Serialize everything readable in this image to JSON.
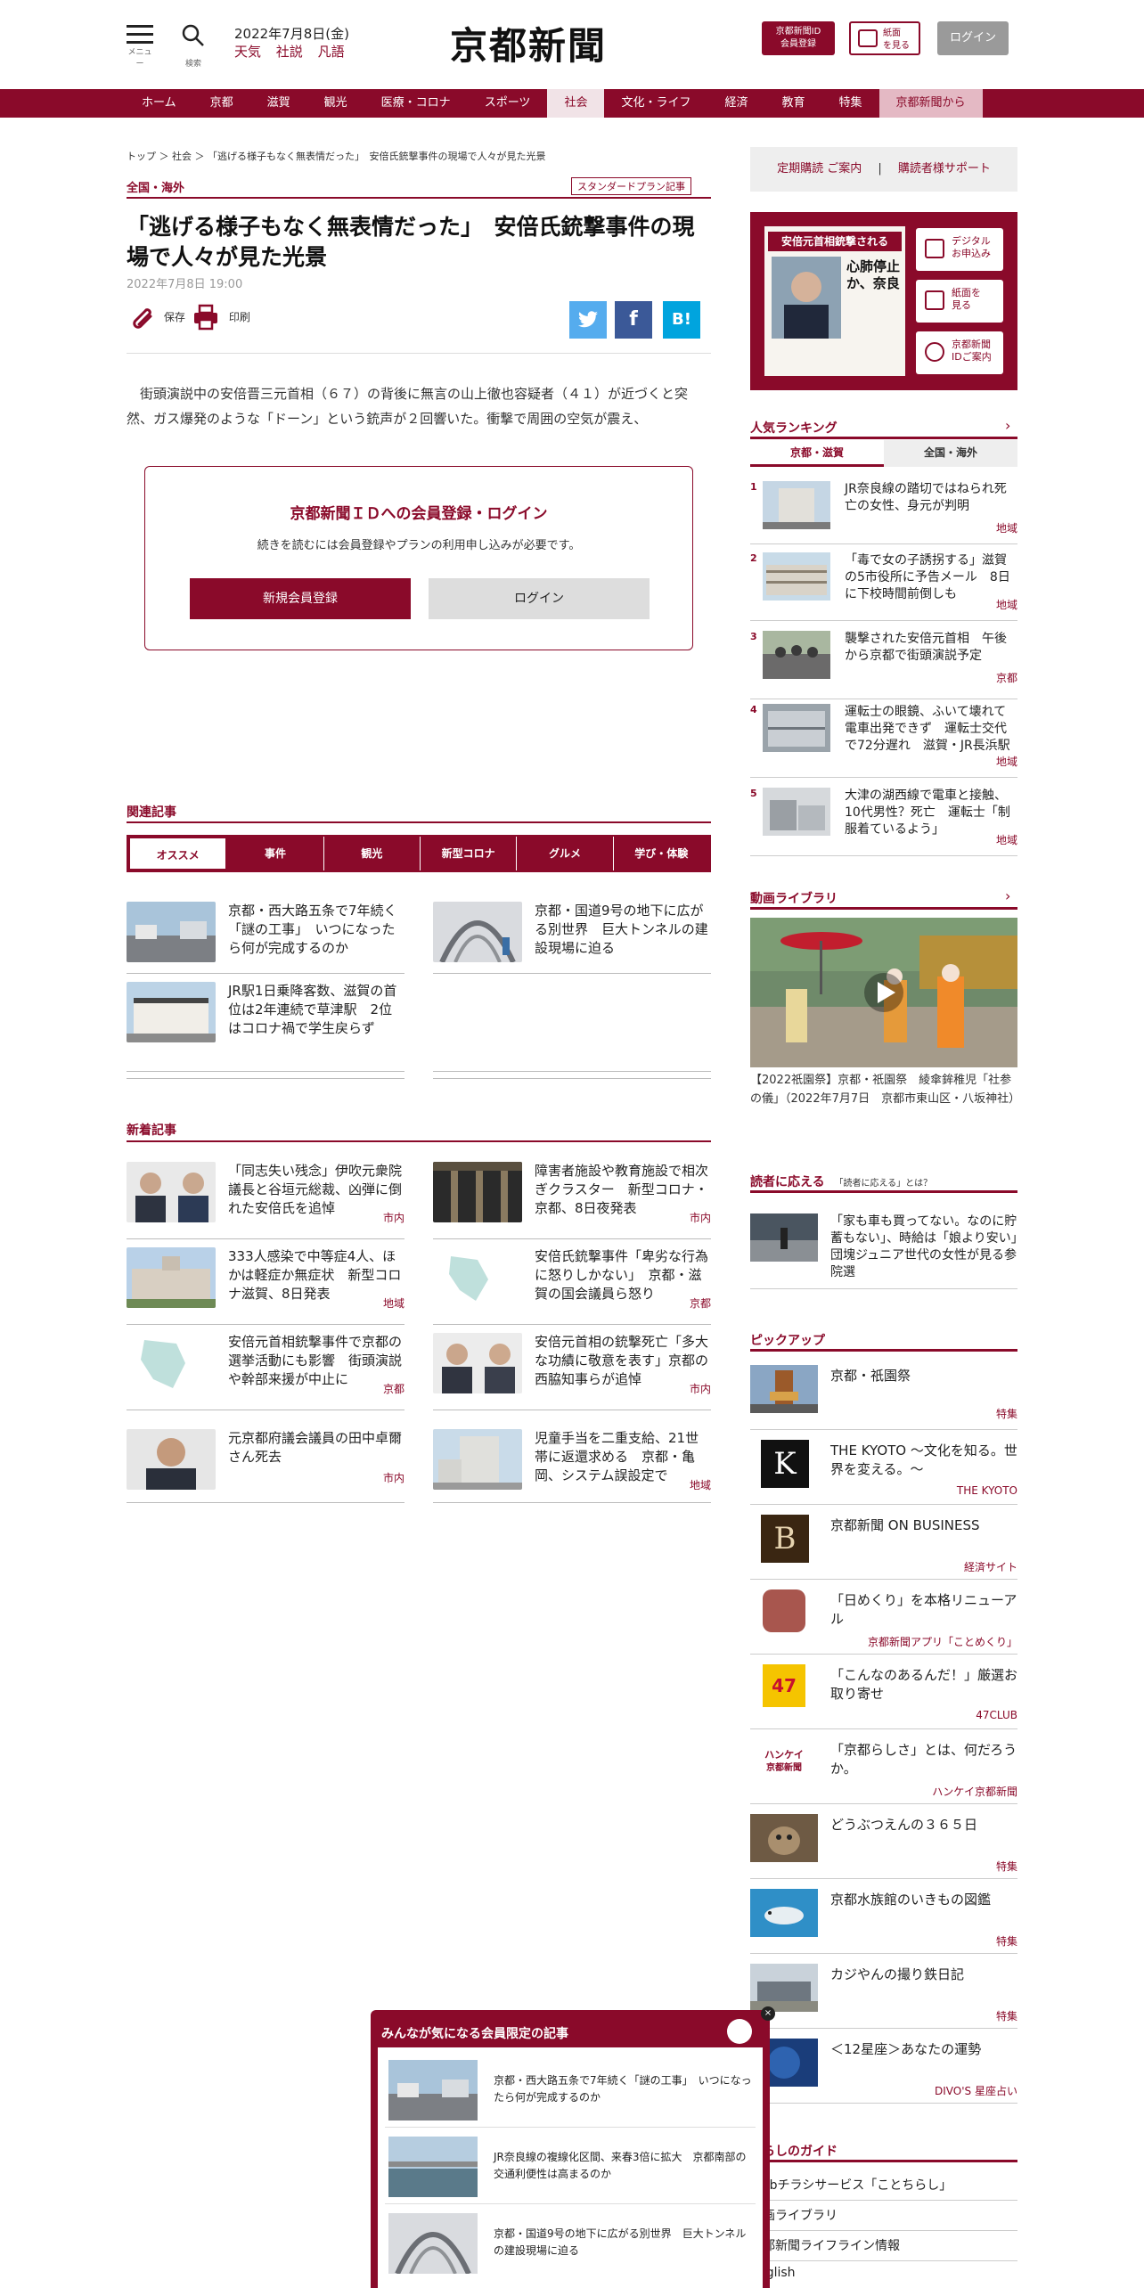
{
  "header": {
    "menu_label": "メニュー",
    "search_label": "検索",
    "date": "2022年7月8日(金)",
    "quick_links": [
      "天気",
      "社説",
      "凡語"
    ],
    "logo": "京都新聞",
    "member_register_line1": "京都新聞ID",
    "member_register_line2": "会員登録",
    "paper_view_line1": "紙面",
    "paper_view_line2": "を見る",
    "login": "ログイン"
  },
  "nav": [
    "ホーム",
    "京都",
    "滋賀",
    "観光",
    "医療・コロナ",
    "スポーツ",
    "社会",
    "文化・ライフ",
    "経済",
    "教育",
    "特集",
    "京都新聞から"
  ],
  "breadcrumb": "トップ ＞ 社会 ＞ 「逃げる様子もなく無表情だった」　安倍氏銃撃事件の現場で人々が見た光景",
  "article": {
    "category": "全国・海外",
    "plan_badge": "スタンダードプラン記事",
    "title": "「逃げる様子もなく無表情だった」　安倍氏銃撃事件の現場で人々が見た光景",
    "published": "2022年7月8日 19:00",
    "save": "保存",
    "print": "印刷",
    "lead": "街頭演説中の安倍晋三元首相（６７）の背後に無言の山上徹也容疑者（４１）が近づくと突然、ガス爆発のような「ドーン」という銃声が２回響いた。衝撃で周囲の空気が震え、"
  },
  "share": {
    "twitter": "t",
    "facebook": "f",
    "hatena": "B!"
  },
  "login_box": {
    "heading": "京都新聞ＩＤへの会員登録・ログイン",
    "text": "続きを読むには会員登録やプランの利用申し込みが必要です。",
    "register": "新規会員登録",
    "login": "ログイン"
  },
  "related": {
    "heading": "関連記事",
    "tabs": [
      "オススメ",
      "事件",
      "観光",
      "新型コロナ",
      "グルメ",
      "学び・体験"
    ],
    "items": [
      {
        "text": "京都・西大路五条で7年続く「謎の工事」　いつになったら何が完成するのか"
      },
      {
        "text": "京都・国道9号の地下に広がる別世界　巨大トンネルの建設現場に迫る"
      },
      {
        "text": "JR駅1日乗降客数、滋賀の首位は2年連続で草津駅　2位はコロナ禍で学生戻らず"
      }
    ]
  },
  "latest": {
    "heading": "新着記事",
    "items": [
      {
        "text": "「同志失い残念」伊吹元衆院議長と谷垣元総裁、凶弾に倒れた安倍氏を追悼",
        "tag": "市内"
      },
      {
        "text": "障害者施設や教育施設で相次ぎクラスター　新型コロナ・京都、8日夜発表",
        "tag": "市内"
      },
      {
        "text": "333人感染で中等症4人、ほかは軽症か無症状　新型コロナ滋賀、8日発表",
        "tag": "地域"
      },
      {
        "text": "安倍氏銃撃事件「卑劣な行為に怒りしかない」　京都・滋賀の国会議員ら怒り",
        "tag": "京都"
      },
      {
        "text": "安倍元首相銃撃事件で京都の選挙活動にも影響　街頭演説や幹部来援が中止に",
        "tag": "京都"
      },
      {
        "text": "安倍元首相の銃撃死亡「多大な功績に敬意を表す」京都の西脇知事らが追悼",
        "tag": "市内"
      },
      {
        "text": "元京都府議会議員の田中卓爾さん死去",
        "tag": "市内"
      },
      {
        "text": "児童手当を二重支給、21世帯に返還求める　京都・亀岡、システム誤設定で",
        "tag": "地域"
      }
    ]
  },
  "sidebar": {
    "subscribe": "定期購読 ご案内",
    "support": "購読者様サポート",
    "paper_headline": "安倍元首相銃撃される",
    "paper_sub": "心肺停止か、奈良",
    "paper_buttons": [
      {
        "l1": "デジタル",
        "l2": "お申込み"
      },
      {
        "l1": "紙面を",
        "l2": "見る"
      },
      {
        "l1": "京都新聞",
        "l2": "IDご案内"
      }
    ],
    "ranking": {
      "heading": "人気ランキング",
      "tabs": [
        "京都・滋賀",
        "全国・海外"
      ],
      "items": [
        {
          "rank": "1",
          "text": "JR奈良線の踏切ではねられ死亡の女性、身元が判明",
          "tag": "地域"
        },
        {
          "rank": "2",
          "text": "「毒で女の子誘拐する」滋賀の5市役所に予告メール　8日に下校時間前倒しも",
          "tag": "地域"
        },
        {
          "rank": "3",
          "text": "襲撃された安倍元首相　午後から京都で街頭演説予定",
          "tag": "京都"
        },
        {
          "rank": "4",
          "text": "運転士の眼鏡、ふいて壊れて電車出発できず　運転士交代で72分遅れ　滋賀・JR長浜駅",
          "tag": "地域"
        },
        {
          "rank": "5",
          "text": "大津の湖西線で電車と接触、10代男性？死亡　運転士「制服着ているよう」",
          "tag": "地域"
        }
      ]
    },
    "video": {
      "heading": "動画ライブラリ",
      "caption": "【2022祇園祭】京都・祇園祭　綾傘鉾稚児「社参の儀」（2022年7月7日　京都市東山区・八坂神社）"
    },
    "reader": {
      "heading": "読者に応える",
      "sub": "「読者に応える」とは？",
      "text": "「家も車も買ってない。なのに貯蓄もない」、時給は「娘より安い」団塊ジュニア世代の女性が見る参院選"
    },
    "pickup": {
      "heading": "ピックアップ",
      "items": [
        {
          "text": "京都・祇園祭",
          "tag": "特集"
        },
        {
          "text": "THE KYOTO ～文化を知る。世界を変える。～",
          "tag": "THE KYOTO"
        },
        {
          "text": "京都新聞 ON BUSINESS",
          "tag": "経済サイト"
        },
        {
          "text": "「日めくり」を本格リニューアル",
          "tag": "京都新聞アプリ「ことめくり」"
        },
        {
          "text": "「こんなのあるんだ！」厳選お取り寄せ",
          "tag": "47CLUB"
        },
        {
          "text": "「京都らしさ」とは、何だろうか。",
          "tag": "ハンケイ京都新聞"
        },
        {
          "text": "どうぶつえんの３６５日",
          "tag": "特集"
        },
        {
          "text": "京都水族館のいきもの図鑑",
          "tag": "特集"
        },
        {
          "text": "カジやんの撮り鉄日記",
          "tag": "特集"
        },
        {
          "text": "＜12星座＞あなたの運勢",
          "tag": "DIVO'S 星座占い"
        }
      ],
      "logo_letters": {
        "k": "K",
        "b": "B",
        "hanke_l1": "ハンケイ",
        "hanke_l2": "京都新聞",
        "club": "47"
      }
    },
    "guide": {
      "heading": "くらしのガイド",
      "items": [
        "Webチラシサービス「ことちらし」",
        "動画ライブラリ",
        "京都新聞ライフライン情報",
        "English"
      ]
    }
  },
  "popup": {
    "heading": "みんなが気になる会員限定の記事",
    "close": "×",
    "items": [
      {
        "text": "京都・西大路五条で7年続く「謎の工事」　いつになったら何が完成するのか"
      },
      {
        "text": "JR奈良線の複線化区間、来春3倍に拡大　京都南部の交通利便性は高まるのか"
      },
      {
        "text": "京都・国道9号の地下に広がる別世界　巨大トンネルの建設現場に迫る"
      }
    ]
  },
  "colors": {
    "brand": "#8a0a2a",
    "twitter": "#55acee",
    "facebook": "#3b5998",
    "hatena": "#00a4de"
  }
}
